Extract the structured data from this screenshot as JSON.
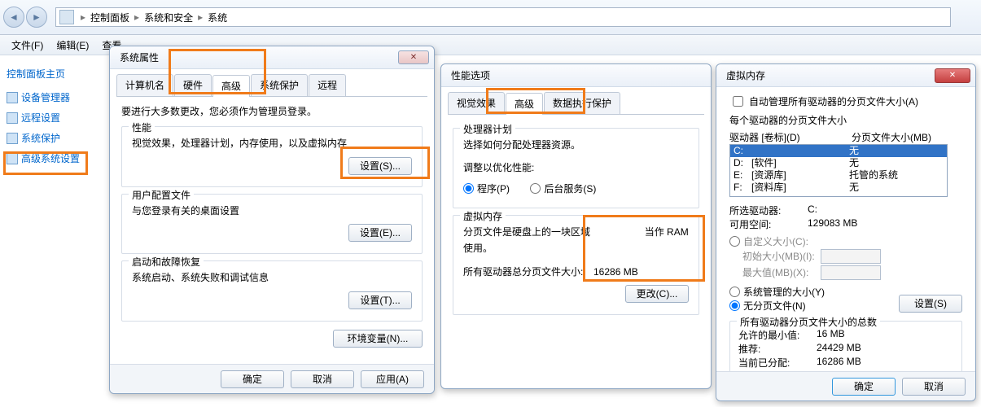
{
  "breadcrumb": {
    "root": "控制面板",
    "lvl2": "系统和安全",
    "lvl3": "系统"
  },
  "menu": {
    "file": "文件(F)",
    "edit": "编辑(E)",
    "view": "查看"
  },
  "leftnav": {
    "heading": "控制面板主页",
    "items": [
      {
        "label": "设备管理器"
      },
      {
        "label": "远程设置"
      },
      {
        "label": "系统保护"
      },
      {
        "label": "高级系统设置"
      }
    ]
  },
  "sysprops": {
    "title": "系统属性",
    "tabs": {
      "computer": "计算机名",
      "hardware": "硬件",
      "advanced": "高级",
      "protect": "系统保护",
      "remote": "远程"
    },
    "admin_notice": "要进行大多数更改，您必须作为管理员登录。",
    "perf": {
      "legend": "性能",
      "desc": "视觉效果，处理器计划，内存使用，以及虚拟内存",
      "btn": "设置(S)..."
    },
    "profile": {
      "legend": "用户配置文件",
      "desc": "与您登录有关的桌面设置",
      "btn": "设置(E)..."
    },
    "startup": {
      "legend": "启动和故障恢复",
      "desc": "系统启动、系统失败和调试信息",
      "btn": "设置(T)..."
    },
    "envvar_btn": "环境变量(N)...",
    "ok": "确定",
    "cancel": "取消",
    "apply": "应用(A)"
  },
  "perfopts": {
    "title": "性能选项",
    "tabs": {
      "visual": "视觉效果",
      "advanced": "高级",
      "dep": "数据执行保护"
    },
    "sched": {
      "legend": "处理器计划",
      "desc": "选择如何分配处理器资源。",
      "adjust_label": "调整以优化性能:",
      "program": "程序(P)",
      "service": "后台服务(S)"
    },
    "vm": {
      "legend": "虚拟内存",
      "desc_prefix": "分页文件是硬盘上的一块区域",
      "desc_suffix": "当作 RAM 使用。",
      "total_label": "所有驱动器总分页文件大小:",
      "total_value": "16286 MB",
      "btn": "更改(C)..."
    }
  },
  "vmem": {
    "title": "虚拟内存",
    "auto_manage": "自动管理所有驱动器的分页文件大小(A)",
    "each_drive": "每个驱动器的分页文件大小",
    "hdr_drive": "驱动器 [卷标](D)",
    "hdr_size": "分页文件大小(MB)",
    "rows": [
      {
        "letter": "C:",
        "label": "",
        "size": "无"
      },
      {
        "letter": "D:",
        "label": "[软件]",
        "size": "无"
      },
      {
        "letter": "E:",
        "label": "[资源库]",
        "size": "托管的系统"
      },
      {
        "letter": "F:",
        "label": "[资料库]",
        "size": "无"
      }
    ],
    "sel_drive_k": "所选驱动器:",
    "sel_drive_v": "C:",
    "avail_k": "可用空间:",
    "avail_v": "129083 MB",
    "custom": "自定义大小(C):",
    "init_k": "初始大小(MB)(I):",
    "max_k": "最大值(MB)(X):",
    "system_managed": "系统管理的大小(Y)",
    "no_paging": "无分页文件(N)",
    "set_btn": "设置(S)",
    "totals_legend": "所有驱动器分页文件大小的总数",
    "min_k": "允许的最小值:",
    "min_v": "16 MB",
    "rec_k": "推荐:",
    "rec_v": "24429 MB",
    "cur_k": "当前已分配:",
    "cur_v": "16286 MB",
    "ok": "确定",
    "cancel": "取消"
  }
}
